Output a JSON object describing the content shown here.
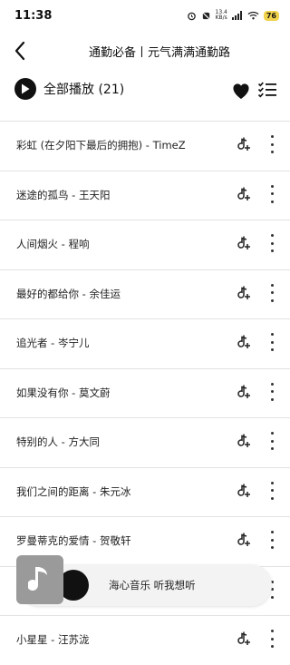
{
  "status_bar": {
    "time": "11:38",
    "net_speed_value": "13.4",
    "net_speed_unit": "KB/s",
    "battery": "76",
    "battery_color": "#f0d24b"
  },
  "header": {
    "title": "通勤必备丨元气满满通勤路"
  },
  "toolbar": {
    "play_all_label": "全部播放 (21)"
  },
  "songs": [
    {
      "title": "彩虹 (在夕阳下最后的拥抱) - TimeZ"
    },
    {
      "title": "迷途的孤鸟 - 王天阳"
    },
    {
      "title": "人间烟火 - 程响"
    },
    {
      "title": "最好的都给你 - 余佳运"
    },
    {
      "title": "追光者 - 岑宁儿"
    },
    {
      "title": "如果没有你 - 莫文蔚"
    },
    {
      "title": "特别的人 - 方大同"
    },
    {
      "title": "我们之间的距离 - 朱元冰"
    },
    {
      "title": "罗曼蒂克的爱情 - 贺敬轩"
    },
    {
      "title": ""
    },
    {
      "title": "小星星 - 汪苏泷"
    }
  ],
  "mini_player": {
    "text": "海心音乐 听我想听"
  },
  "icons": {
    "back": "chevron-left-icon",
    "play": "play-icon",
    "favorite": "heart-icon",
    "multi_select": "checklist-icon",
    "add": "add-to-playlist-icon",
    "more": "more-vertical-icon",
    "cover": "music-note-icon"
  }
}
